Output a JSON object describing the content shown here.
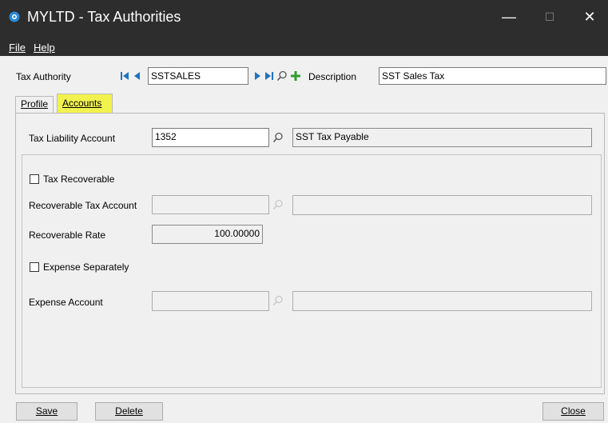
{
  "window": {
    "title": "MYLTD - Tax Authorities",
    "minimize_glyph": "—",
    "maximize_glyph": "☐",
    "close_glyph": "✕"
  },
  "menu": {
    "file": "File",
    "help": "Help"
  },
  "header": {
    "tax_authority_label": "Tax Authority",
    "tax_authority_value": "SSTSALES",
    "description_label": "Description",
    "description_value": "SST Sales Tax"
  },
  "tabs": {
    "profile": "Profile",
    "accounts": "Accounts"
  },
  "accounts": {
    "liability_label": "Tax Liability Account",
    "liability_value": "1352",
    "liability_description": "SST Tax Payable",
    "tax_recoverable_label": "Tax Recoverable",
    "tax_recoverable_checked": false,
    "recoverable_account_label": "Recoverable Tax Account",
    "recoverable_account_value": "",
    "recoverable_account_description": "",
    "recoverable_rate_label": "Recoverable Rate",
    "recoverable_rate_value": "100.00000",
    "expense_separately_label": "Expense Separately",
    "expense_separately_checked": false,
    "expense_account_label": "Expense Account",
    "expense_account_value": "",
    "expense_account_description": ""
  },
  "buttons": {
    "save": "Save",
    "delete": "Delete",
    "close": "Close"
  },
  "colors": {
    "titlebar": "#2d2d2d",
    "active_tab": "#f2f24e",
    "nav_arrow": "#1e73be",
    "add_plus": "#2e9e2e",
    "app_icon": "#2a8ad8"
  },
  "icons": {
    "nav_first": "first-record-icon",
    "nav_prev": "previous-record-icon",
    "nav_next": "next-record-icon",
    "nav_last": "last-record-icon",
    "finder": "magnifier-icon",
    "new": "plus-icon"
  }
}
